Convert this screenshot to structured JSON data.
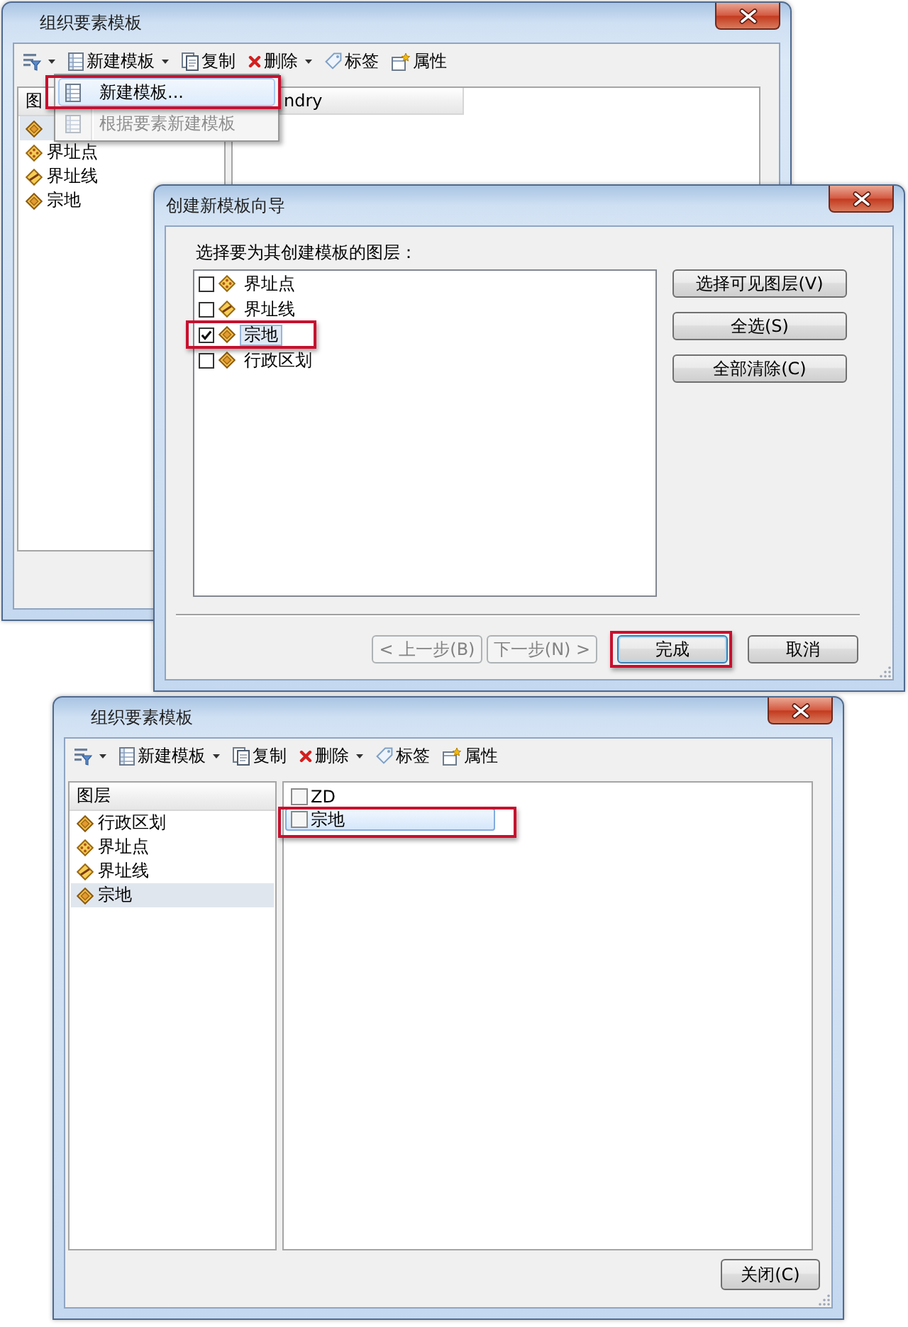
{
  "top_window": {
    "title": "组织要素模板",
    "toolbar": [
      {
        "kind": "filter",
        "dropdown": true
      },
      {
        "kind": "template",
        "label": "新建模板",
        "dropdown": true
      },
      {
        "kind": "copy",
        "label": "复制",
        "dropdown": false
      },
      {
        "kind": "delete",
        "label": "删除",
        "dropdown": true
      },
      {
        "kind": "tag",
        "label": "标签",
        "dropdown": false
      },
      {
        "kind": "properties",
        "label": "属性",
        "dropdown": false
      }
    ],
    "layers_header": "图",
    "layers": [
      {
        "kind": "polygon",
        "selected": true
      },
      {
        "label": "界址点",
        "kind": "point",
        "selected": false
      },
      {
        "label": "界址线",
        "kind": "line",
        "selected": false
      },
      {
        "label": "宗地",
        "kind": "polygon",
        "selected": false
      }
    ],
    "templates_header": "ndry",
    "menu": [
      {
        "label": "新建模板...",
        "selected": true,
        "disabled": false,
        "callout": true
      },
      {
        "label": "根据要素新建模板",
        "selected": false,
        "disabled": true,
        "callout": false
      }
    ]
  },
  "wizard": {
    "title": "创建新模板向导",
    "prompt": "选择要为其创建模板的图层：",
    "layers": [
      {
        "label": "界址点",
        "kind": "point",
        "checked": false,
        "selected": false,
        "callout": false
      },
      {
        "label": "界址线",
        "kind": "line",
        "checked": false,
        "selected": false,
        "callout": false
      },
      {
        "label": "宗地",
        "kind": "polygon",
        "checked": true,
        "selected": true,
        "callout": true
      },
      {
        "label": "行政区划",
        "kind": "polygon",
        "checked": false,
        "selected": false,
        "callout": false
      }
    ],
    "side_buttons": [
      "选择可见图层(V)",
      "全选(S)",
      "全部清除(C)"
    ],
    "nav_buttons": [
      {
        "label": "< 上一步(B)",
        "disabled": true,
        "default": false,
        "callout": false
      },
      {
        "label": "下一步(N) >",
        "disabled": true,
        "default": false,
        "callout": false
      },
      {
        "label": "完成",
        "disabled": false,
        "default": true,
        "callout": true
      },
      {
        "label": "取消",
        "disabled": false,
        "default": false,
        "callout": false
      }
    ],
    "resize_grip": true
  },
  "bottom_window": {
    "title": "组织要素模板",
    "toolbar": [
      {
        "kind": "filter",
        "dropdown": true
      },
      {
        "kind": "template",
        "label": "新建模板",
        "dropdown": true
      },
      {
        "kind": "copy",
        "label": "复制",
        "dropdown": false
      },
      {
        "kind": "delete",
        "label": "删除",
        "dropdown": true
      },
      {
        "kind": "tag",
        "label": "标签",
        "dropdown": false
      },
      {
        "kind": "properties",
        "label": "属性",
        "dropdown": false
      }
    ],
    "layers_header": "图层",
    "layers": [
      {
        "label": "行政区划",
        "kind": "polygon",
        "selected": false
      },
      {
        "label": "界址点",
        "kind": "point",
        "selected": false
      },
      {
        "label": "界址线",
        "kind": "line",
        "selected": false
      },
      {
        "label": "宗地",
        "kind": "polygon",
        "selected": true
      }
    ],
    "templates": [
      {
        "label": "ZD",
        "selected": false,
        "callout": false
      },
      {
        "label": "宗地",
        "selected": true,
        "callout": true
      }
    ],
    "close_button": "关闭(C)",
    "resize_grip": true
  }
}
